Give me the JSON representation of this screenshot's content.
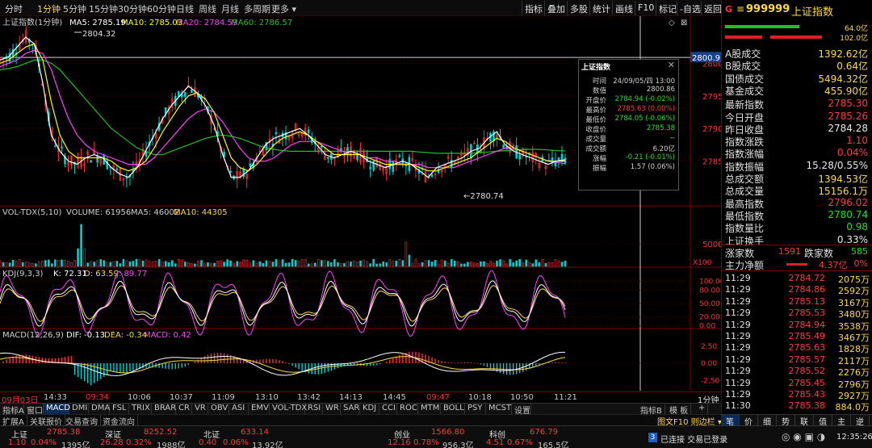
{
  "toolbar": {
    "left_items": [
      "分时",
      "1分钟",
      "5分钟",
      "15分钟",
      "30分钟",
      "60分钟",
      "日线",
      "周线",
      "月线",
      "多周期",
      "更多 ▾"
    ],
    "active_index": 1,
    "right_items": [
      "指标",
      "叠加",
      "多股",
      "统计",
      "画线",
      "F10",
      "标记",
      "-自选",
      "返回"
    ]
  },
  "main_chart": {
    "legend_title": "上证指数(1分钟)",
    "ma5": "MA5: 2785.19",
    "ma10": "MA10: 2785.03",
    "ma20": "MA20: 2784.59",
    "ma60": "MA60: 2786.57",
    "high_label": "2804.32",
    "low_label": "←2780.74",
    "crosshair_price": "2800.9",
    "y_ticks": [
      "2800",
      "2795",
      "2790",
      "2785"
    ],
    "colors": {
      "ma5": "#ffffff",
      "ma10": "#ffff00",
      "ma20": "#ff40ff",
      "ma60": "#20c020",
      "up": "#ff3030",
      "down": "#00d0d0"
    }
  },
  "chart_data": {
    "type": "line",
    "x_start": "09:31",
    "x_end": "11:29",
    "ylim": [
      2779,
      2806
    ],
    "ma5": [
      2800.5,
      2801.0,
      2802.5,
      2804.0,
      2803.0,
      2797.0,
      2789.0,
      2786.5,
      2785.0,
      2784.5,
      2785.5,
      2786.0,
      2785.5,
      2784.0,
      2783.0,
      2782.5,
      2784.0,
      2786.5,
      2789.0,
      2791.5,
      2793.5,
      2795.0,
      2796.5,
      2795.5,
      2793.5,
      2790.5,
      2786.0,
      2782.5,
      2782.5,
      2783.5,
      2785.5,
      2787.5,
      2788.5,
      2789.0,
      2789.5,
      2790.0,
      2789.0,
      2787.5,
      2786.0,
      2785.5,
      2786.0,
      2786.5,
      2786.0,
      2785.0,
      2784.5,
      2784.0,
      2784.5,
      2785.0,
      2784.5,
      2783.5,
      2782.5,
      2784.0,
      2784.5,
      2785.0,
      2785.5,
      2786.5,
      2787.0,
      2788.5,
      2789.5,
      2787.5,
      2786.5,
      2786.0,
      2785.5,
      2785.0,
      2784.5,
      2785.0,
      2785.2
    ],
    "ma10": [
      2800.0,
      2800.5,
      2801.5,
      2802.5,
      2803.0,
      2800.5,
      2794.0,
      2789.0,
      2786.5,
      2785.5,
      2785.5,
      2785.5,
      2785.5,
      2785.0,
      2784.0,
      2783.5,
      2784.0,
      2785.0,
      2787.0,
      2789.5,
      2791.5,
      2793.5,
      2795.0,
      2795.5,
      2794.5,
      2792.5,
      2789.0,
      2785.5,
      2784.0,
      2783.5,
      2784.5,
      2786.0,
      2787.5,
      2788.5,
      2789.0,
      2789.5,
      2789.0,
      2788.0,
      2787.0,
      2786.0,
      2786.0,
      2786.0,
      2786.0,
      2785.5,
      2785.0,
      2784.5,
      2784.5,
      2784.5,
      2784.5,
      2784.0,
      2783.5,
      2783.5,
      2784.0,
      2784.5,
      2785.0,
      2785.5,
      2786.5,
      2787.5,
      2788.5,
      2788.0,
      2787.0,
      2786.5,
      2786.0,
      2785.5,
      2785.0,
      2785.0,
      2785.0
    ],
    "ma20": [
      2799.5,
      2800.0,
      2800.5,
      2801.5,
      2802.0,
      2801.5,
      2799.0,
      2795.0,
      2791.5,
      2789.0,
      2787.5,
      2786.5,
      2786.0,
      2785.5,
      2785.0,
      2784.5,
      2784.5,
      2784.5,
      2785.5,
      2787.0,
      2788.5,
      2790.0,
      2791.5,
      2792.5,
      2793.0,
      2792.5,
      2791.0,
      2789.0,
      2787.0,
      2785.5,
      2785.0,
      2785.0,
      2785.5,
      2786.5,
      2787.5,
      2788.0,
      2788.0,
      2788.0,
      2787.5,
      2787.0,
      2786.5,
      2786.0,
      2786.0,
      2785.5,
      2785.5,
      2785.0,
      2785.0,
      2784.5,
      2784.5,
      2784.5,
      2784.0,
      2784.0,
      2784.0,
      2784.0,
      2784.5,
      2785.0,
      2785.5,
      2786.0,
      2786.5,
      2787.0,
      2787.0,
      2786.5,
      2786.0,
      2785.5,
      2785.0,
      2784.8,
      2784.6
    ],
    "ma60": [
      2799.0,
      2799.2,
      2799.5,
      2800.0,
      2800.5,
      2800.5,
      2800.0,
      2799.0,
      2797.5,
      2796.0,
      2794.5,
      2793.0,
      2791.5,
      2790.0,
      2789.0,
      2788.0,
      2787.0,
      2786.5,
      2786.0,
      2786.0,
      2786.5,
      2787.0,
      2787.5,
      2788.0,
      2788.5,
      2788.8,
      2789.0,
      2788.8,
      2788.5,
      2788.0,
      2787.5,
      2787.0,
      2786.8,
      2786.6,
      2786.5,
      2786.5,
      2786.5,
      2786.5,
      2786.5,
      2786.5,
      2786.5,
      2786.5,
      2786.5,
      2786.5,
      2786.5,
      2786.5,
      2786.5,
      2786.5,
      2786.5,
      2786.4,
      2786.3,
      2786.2,
      2786.2,
      2786.2,
      2786.2,
      2786.2,
      2786.3,
      2786.4,
      2786.5,
      2786.6,
      2786.7,
      2786.8,
      2786.8,
      2786.8,
      2786.7,
      2786.6,
      2786.57
    ]
  },
  "volume_panel": {
    "title": "VOL-TDX(5,10)",
    "volume": "VOLUME: 61956",
    "ma5": "MA5: 46002",
    "ma10": "MA10: 44305",
    "y_tick": "5000",
    "unit": "X100"
  },
  "kdj_panel": {
    "title": "KDJ(9,3,3)",
    "k": "K: 72.31",
    "d": "D: 63.59",
    "j": "J: 89.77",
    "y_ticks": [
      "100.00",
      "80.00",
      "50.00",
      "20.00",
      "0.00"
    ]
  },
  "macd_panel": {
    "title": "MACD(12,26,9)",
    "dif": "DIF: -0.13",
    "dea": "DEA: -0.34",
    "macd": "MACD: 0.42",
    "y_ticks": [
      "2.50",
      "0.00",
      "-2.50"
    ]
  },
  "tooltip": {
    "title": "上证指数",
    "rows": [
      {
        "label": "时间",
        "value": "24/09/05/四 13:00",
        "color": "#d0d0d0"
      },
      {
        "label": "数值",
        "value": "2800.86",
        "color": "#d0d0d0"
      },
      {
        "label": "开盘价",
        "value": "2784.94 (-0.02%)",
        "color": "#20e020"
      },
      {
        "label": "最高价",
        "value": "2785.63 (0.00%)",
        "color": "#ff3b3b"
      },
      {
        "label": "最低价",
        "value": "2784.05 (-0.06%)",
        "color": "#20e020"
      },
      {
        "label": "收盘价",
        "value": "2785.38",
        "color": "#20e020"
      },
      {
        "label": "成交量",
        "value": "--",
        "color": "#d0d0d0"
      },
      {
        "label": "成交额",
        "value": "6.20亿",
        "color": "#d0d0d0"
      },
      {
        "label": "涨幅",
        "value": "-0.21 (-0.01%)",
        "color": "#20e020"
      },
      {
        "label": "振幅",
        "value": "1.57 (0.06%)",
        "color": "#d0d0d0"
      }
    ]
  },
  "time_axis": {
    "ticks": [
      "09月03日",
      "14:33",
      "09:34",
      "10:06",
      "10:37",
      "11:09",
      "13:10",
      "13:42",
      "14:13",
      "14:45",
      "09:47",
      "10:18",
      "10:50",
      "11:21"
    ],
    "red_indices": [
      0,
      2,
      10
    ]
  },
  "indicator_tabs": [
    "指标A",
    "窗口",
    "MACD",
    "DMI",
    "DMA",
    "FSL",
    "TRIX",
    "BRAR",
    "CR",
    "VR",
    "OBV",
    "ASI",
    "EMV",
    "VOL-TDX",
    "RSI",
    "WR",
    "SAR",
    "KDJ",
    "CCI",
    "ROC",
    "MTM",
    "BOLL",
    "PSY",
    "MCST",
    "设置"
  ],
  "indicator_active": 2,
  "indicator_right": [
    "指标B",
    "模 板",
    "+"
  ],
  "ext_tabs": [
    "扩展A",
    "关联报价",
    "交易查询",
    "资金流向"
  ],
  "ext_right": "图文F10 则边栏 ▾",
  "period_label": "1分钟",
  "right_panel": {
    "header_code": "999999",
    "header_name": "上证指数",
    "bar1_value": "64.0亿",
    "bar2_value": "102.0亿",
    "rows": [
      {
        "label": "A股成交",
        "value": "1392.62亿",
        "color": "yellow"
      },
      {
        "label": "B股成交",
        "value": "0.64亿",
        "color": "yellow"
      },
      {
        "label": "国债成交",
        "value": "5494.32亿",
        "color": "yellow"
      },
      {
        "label": "基金成交",
        "value": "455.90亿",
        "color": "yellow"
      },
      {
        "label": "最新指数",
        "value": "2785.30",
        "color": "red"
      },
      {
        "label": "今日开盘",
        "value": "2785.26",
        "color": "red"
      },
      {
        "label": "昨日收盘",
        "value": "2784.28",
        "color": "white"
      },
      {
        "label": "指数涨跌",
        "value": "1.10",
        "color": "red"
      },
      {
        "label": "指数涨幅",
        "value": "0.04%",
        "color": "red"
      },
      {
        "label": "指数振幅",
        "value": "15.28/0.55%",
        "color": "white"
      },
      {
        "label": "总成交额",
        "value": "1394.53亿",
        "color": "yellow"
      },
      {
        "label": "总成交量",
        "value": "15156.1万",
        "color": "yellow"
      },
      {
        "label": "最高指数",
        "value": "2796.02",
        "color": "red"
      },
      {
        "label": "最低指数",
        "value": "2780.74",
        "color": "green"
      },
      {
        "label": "指数量比",
        "value": "0.98",
        "color": "green"
      },
      {
        "label": "上证换手",
        "value": "0.33%",
        "color": "white"
      }
    ],
    "up_label": "涨家数",
    "up_count": "1591",
    "down_label": "跌家数",
    "down_count": "585",
    "net_label": "主力净额",
    "net_value": "4.37亿",
    "net_pct": "0%",
    "trades": [
      {
        "time": "11:29",
        "price": "2784.72",
        "vol": "2075万"
      },
      {
        "time": "11:29",
        "price": "2784.86",
        "vol": "2592万"
      },
      {
        "time": "11:29",
        "price": "2785.13",
        "vol": "3167万"
      },
      {
        "time": "11:29",
        "price": "2785.53",
        "vol": "3480万"
      },
      {
        "time": "11:29",
        "price": "2784.94",
        "vol": "3538万"
      },
      {
        "time": "11:29",
        "price": "2785.49",
        "vol": "3467万"
      },
      {
        "time": "11:29",
        "price": "2785.63",
        "vol": "1828万"
      },
      {
        "time": "11:29",
        "price": "2785.57",
        "vol": "2117万"
      },
      {
        "time": "11:29",
        "price": "2785.52",
        "vol": "2276万"
      },
      {
        "time": "11:29",
        "price": "2785.45",
        "vol": "2796万"
      },
      {
        "time": "11:29",
        "price": "2785.43",
        "vol": "2927万"
      },
      {
        "time": "11:30",
        "price": "2785.38",
        "vol": "884.0万"
      }
    ],
    "bottom_tabs": [
      "笔",
      "价",
      "细",
      "势",
      "联",
      "值",
      "主",
      "逆"
    ]
  },
  "status_bar": {
    "sh_label": "上证",
    "sh_value": "2785.38",
    "sh_change": "1.10",
    "sh_pct": "0.04%",
    "sh_amount": "1395亿",
    "sz_label": "深证",
    "sz_value": "8252.52",
    "sz_change": "26.28",
    "sz_pct": "0.32%",
    "sz_amount": "1988亿",
    "bz_label": "北证",
    "bz_value": "633.14",
    "bz_change": "0.40",
    "bz_pct": "0.06%",
    "bz_amount": "13.92亿",
    "cy_label": "创业",
    "cy_value": "1566.80",
    "cy_change": "12.16",
    "cy_pct": "0.78%",
    "cy_amount": "956.3亿",
    "kc_label": "科创",
    "kc_value": "676.79",
    "kc_change": "4.51",
    "kc_pct": "0.67%",
    "kc_amount": "165.5亿",
    "badge": "3",
    "connect": "已连接 交易已登录",
    "clock": "12:35:26"
  }
}
